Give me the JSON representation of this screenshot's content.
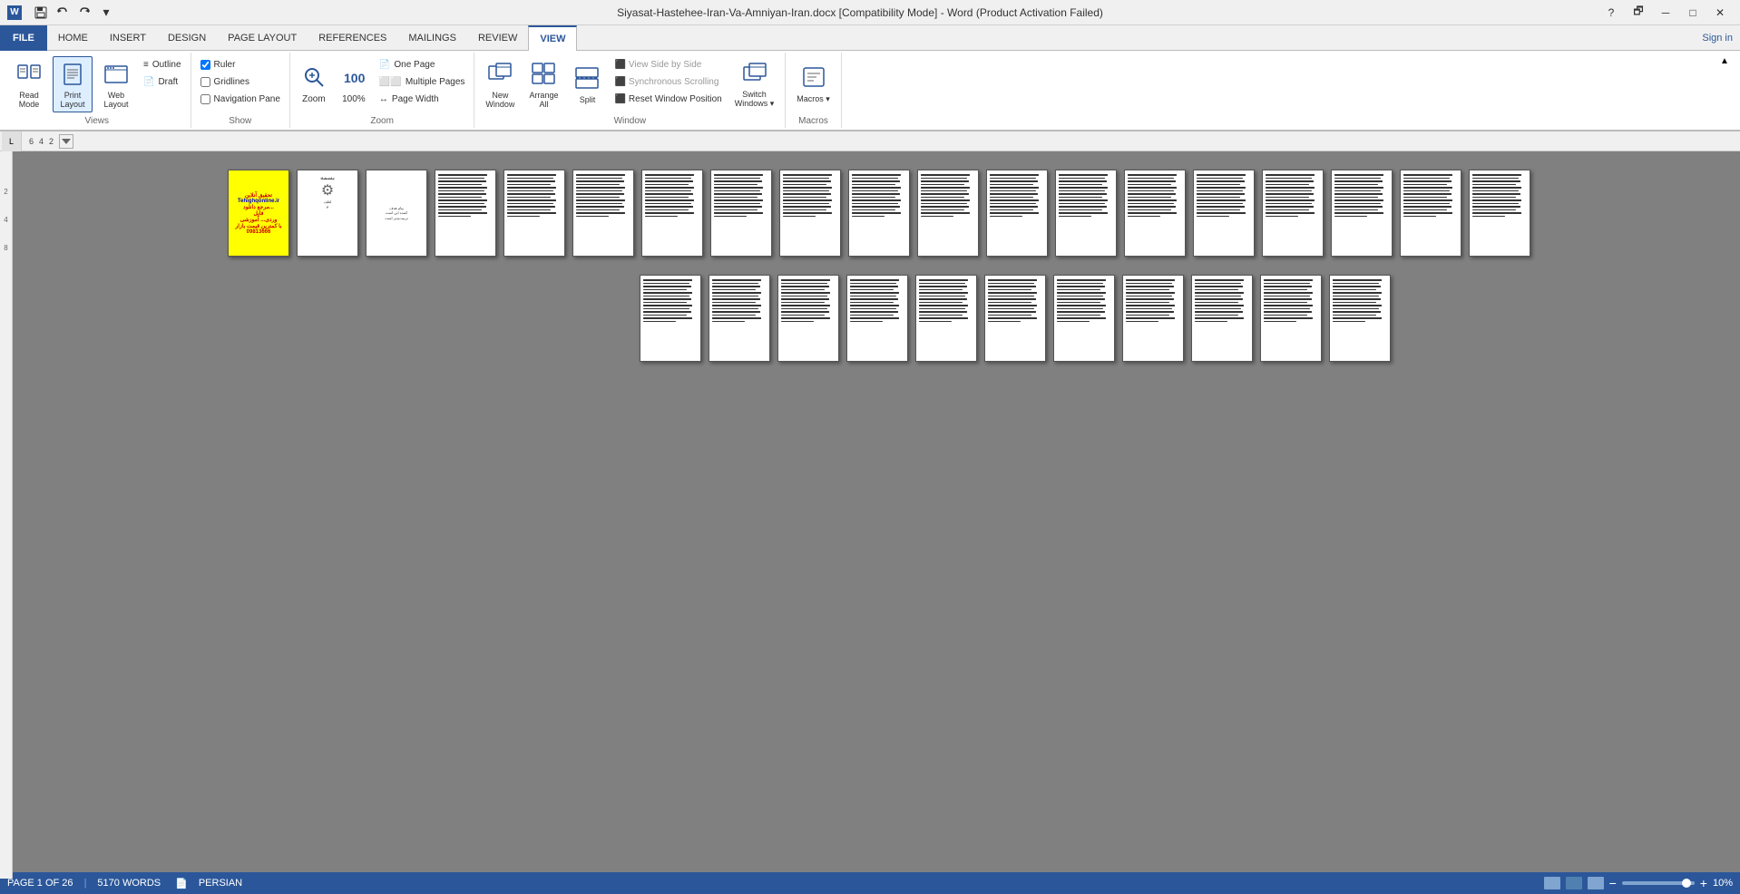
{
  "titlebar": {
    "title": "Siyasat-Hastehee-Iran-Va-Amniyan-Iran.docx [Compatibility Mode] - Word (Product Activation Failed)",
    "help_label": "?",
    "restore_label": "🗗",
    "minimize_label": "─",
    "maximize_label": "□",
    "close_label": "✕",
    "word_icon": "W"
  },
  "qat": {
    "save_label": "💾",
    "undo_label": "↩",
    "redo_label": "↪",
    "customize_label": "▾"
  },
  "ribbon": {
    "tabs": [
      "FILE",
      "HOME",
      "INSERT",
      "DESIGN",
      "PAGE LAYOUT",
      "REFERENCES",
      "MAILINGS",
      "REVIEW",
      "VIEW"
    ],
    "active_tab": "VIEW",
    "sign_in": "Sign in",
    "groups": {
      "views": {
        "label": "Views",
        "read_mode": "Read\nMode",
        "print_layout": "Print\nLayout",
        "web_layout": "Web\nLayout",
        "outline": "Outline",
        "draft": "Draft"
      },
      "show": {
        "label": "Show",
        "ruler": "Ruler",
        "gridlines": "Gridlines",
        "navigation_pane": "Navigation Pane"
      },
      "zoom": {
        "label": "Zoom",
        "zoom": "Zoom",
        "zoom_100": "100%",
        "one_page": "One Page",
        "multiple_pages": "Multiple Pages",
        "page_width": "Page Width"
      },
      "window": {
        "label": "Window",
        "new_window": "New\nWindow",
        "arrange_all": "Arrange\nAll",
        "split": "Split",
        "view_side_by_side": "View Side by Side",
        "sync_scrolling": "Synchronous Scrolling",
        "reset_window": "Reset Window Position",
        "switch_windows": "Switch\nWindows"
      },
      "macros": {
        "label": "Macros",
        "macros": "Macros"
      }
    }
  },
  "ruler": {
    "marks": [
      "L",
      "6",
      "4",
      "2"
    ],
    "vertical_marks": [
      "2",
      "4",
      "8"
    ]
  },
  "document": {
    "pages_row1_count": 19,
    "pages_row2_count": 11,
    "has_cover": true,
    "has_gear_page": true
  },
  "statusbar": {
    "page_info": "PAGE 1 OF 26",
    "word_count": "5170 WORDS",
    "language": "PERSIAN",
    "zoom_percent": "10%"
  }
}
